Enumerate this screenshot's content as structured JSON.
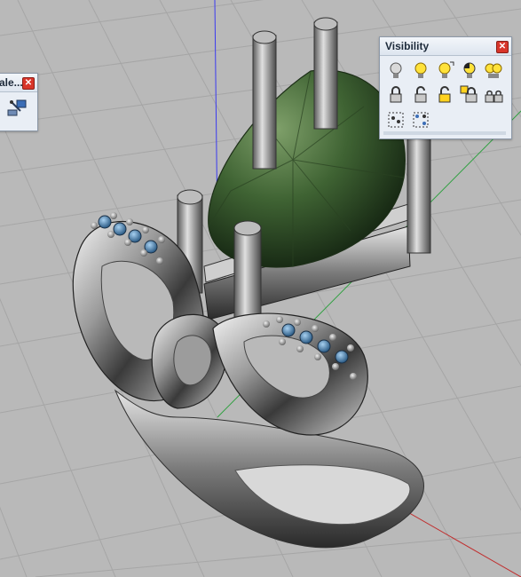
{
  "viewport": {
    "background": "#b9b9b9",
    "grid_color": "#a6a6a6",
    "axis_colors": {
      "x": "#c03030",
      "y": "#2fa040",
      "z": "#3a3af0"
    },
    "model": "ring"
  },
  "scale_panel": {
    "title": "ale...",
    "close_icon": "close-icon",
    "tools": [
      "scale-1d-icon"
    ]
  },
  "visibility_panel": {
    "title": "Visibility",
    "close_icon": "close-icon",
    "rows": [
      [
        "show-objects-icon",
        "show-selected-icon",
        "hide-swap-icon",
        "hide-objects-icon",
        "show-all-icon"
      ],
      [
        "lock-icon",
        "unlock-icon",
        "unlock-selected-icon",
        "lock-swap-icon",
        "lock-all-icon"
      ],
      [
        "select-group-icon",
        "select-points-icon"
      ]
    ]
  }
}
